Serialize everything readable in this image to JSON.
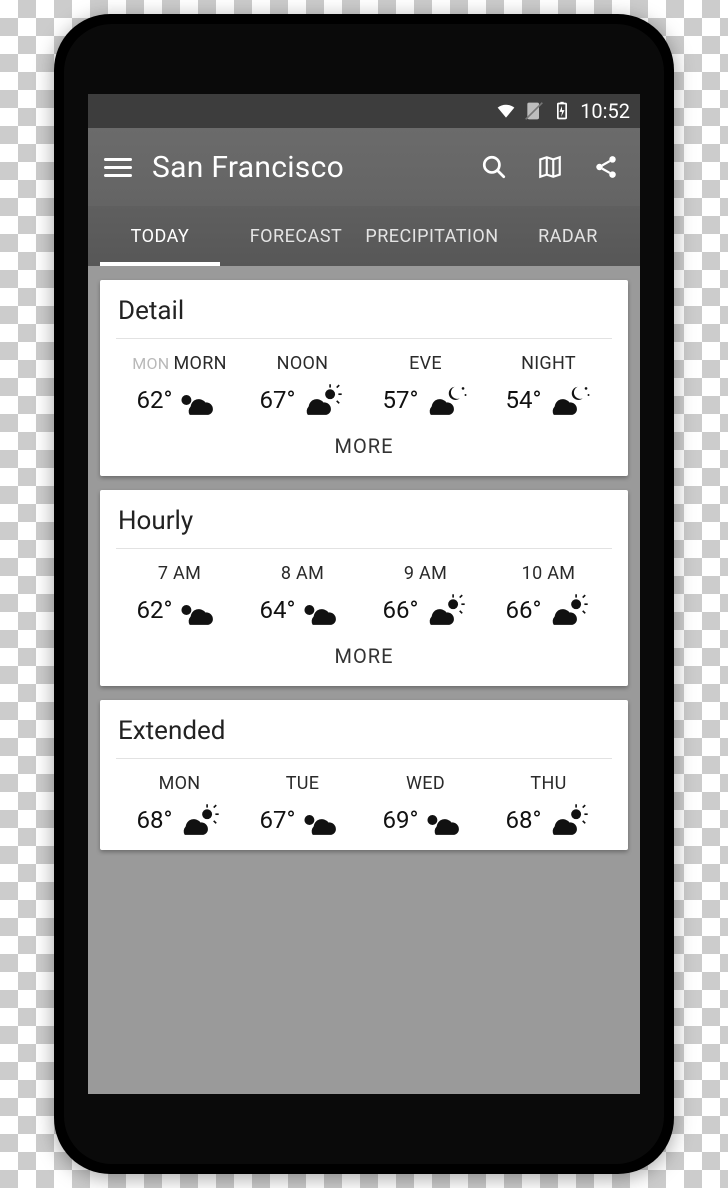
{
  "status": {
    "time": "10:52"
  },
  "appbar": {
    "title": "San Francisco"
  },
  "tabs": [
    {
      "label": "TODAY",
      "active": true
    },
    {
      "label": "FORECAST",
      "active": false
    },
    {
      "label": "PRECIPITATION",
      "active": false
    },
    {
      "label": "RADAR",
      "active": false
    }
  ],
  "detail": {
    "title": "Detail",
    "day_prefix": "MON",
    "items": [
      {
        "label": "MORN",
        "temp": "62°",
        "icon": "cloudy"
      },
      {
        "label": "NOON",
        "temp": "67°",
        "icon": "partly-sunny"
      },
      {
        "label": "EVE",
        "temp": "57°",
        "icon": "night-cloudy"
      },
      {
        "label": "NIGHT",
        "temp": "54°",
        "icon": "night-cloudy"
      }
    ],
    "more": "MORE"
  },
  "hourly": {
    "title": "Hourly",
    "items": [
      {
        "label": "7 AM",
        "temp": "62°",
        "icon": "cloudy"
      },
      {
        "label": "8 AM",
        "temp": "64°",
        "icon": "cloudy"
      },
      {
        "label": "9 AM",
        "temp": "66°",
        "icon": "partly-sunny"
      },
      {
        "label": "10 AM",
        "temp": "66°",
        "icon": "partly-sunny"
      }
    ],
    "more": "MORE"
  },
  "extended": {
    "title": "Extended",
    "items": [
      {
        "label": "MON",
        "temp": "68°",
        "icon": "partly-sunny"
      },
      {
        "label": "TUE",
        "temp": "67°",
        "icon": "cloudy"
      },
      {
        "label": "WED",
        "temp": "69°",
        "icon": "cloudy"
      },
      {
        "label": "THU",
        "temp": "68°",
        "icon": "partly-sunny"
      }
    ]
  }
}
